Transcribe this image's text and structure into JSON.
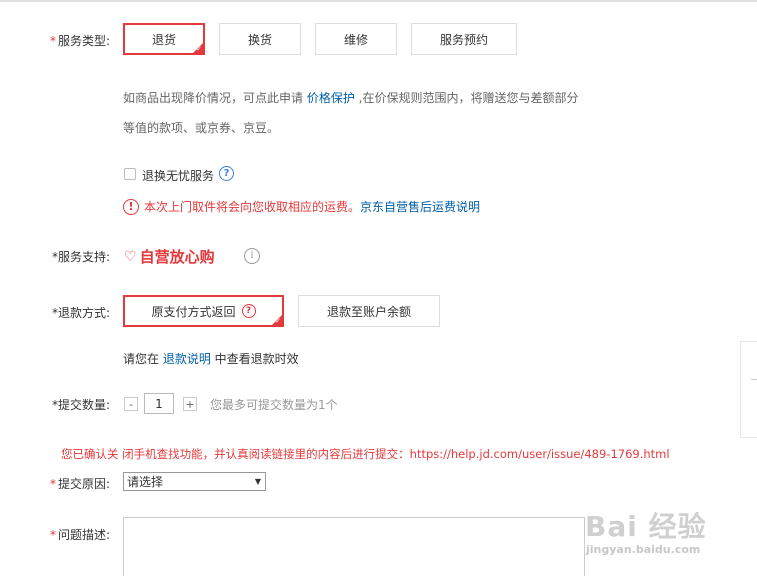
{
  "service_type": {
    "label": "服务类型:",
    "options": [
      {
        "label": "退货",
        "selected": true
      },
      {
        "label": "换货",
        "selected": false
      },
      {
        "label": "维修",
        "selected": false
      },
      {
        "label": "服务预约",
        "selected": false
      }
    ],
    "note_line1_prefix": "如商品出现降价情况，可点此申请 ",
    "note_line1_link": "价格保护",
    "note_line1_suffix": " ,在价保规则范围内，将赠送您与差额部分",
    "note_line2": "等值的款项、或京券、京豆。"
  },
  "worry_free": {
    "label": "退换无忧服务",
    "warning_text": "本次上门取件将会向您收取相应的运费。",
    "warning_link": "京东自营售后运费说明"
  },
  "service_support": {
    "label": "*服务支持:",
    "brand_text": "自营放心购"
  },
  "refund_method": {
    "label": "*退款方式:",
    "options": [
      {
        "label": "原支付方式返回",
        "selected": true
      },
      {
        "label": "退款至账户余额",
        "selected": false
      }
    ],
    "note_prefix": "请您在 ",
    "note_link": "退款说明",
    "note_suffix": " 中查看退款时效"
  },
  "quantity": {
    "label": "*提交数量:",
    "minus": "-",
    "value": "1",
    "plus": "+",
    "hint": "您最多可提交数量为1个"
  },
  "confirm_notice": "您已确认关 闭手机查找功能，并认真阅读链接里的内容后进行提交：https://help.jd.com/user/issue/489-1769.html",
  "reason": {
    "label": "提交原因:",
    "selected": "请选择"
  },
  "description": {
    "label": "问题描述:"
  },
  "watermark": {
    "line1": "Bai 经验",
    "line2": "jingyan.baidu.com"
  },
  "colors": {
    "accent": "#e4393c",
    "link": "#005ea7",
    "help": "#3b7dd8"
  }
}
